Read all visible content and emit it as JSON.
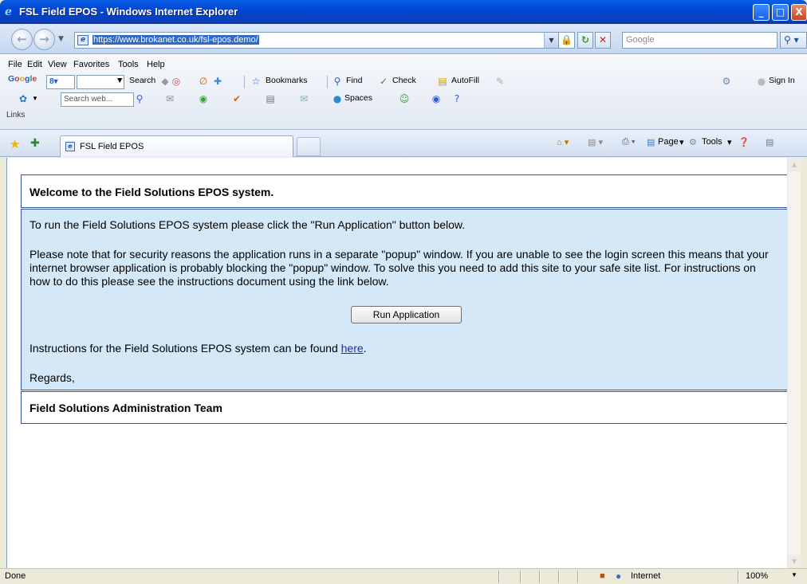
{
  "window": {
    "title": "FSL Field EPOS - Windows Internet Explorer",
    "min_glyph": "_",
    "max_glyph": "□",
    "close_glyph": "X"
  },
  "address": {
    "url": "https://www.brokanet.co.uk/fsl-epos.demo/",
    "search_placeholder": "Google"
  },
  "menu": {
    "items": [
      "File",
      "Edit",
      "View",
      "Favorites",
      "Tools",
      "Help"
    ]
  },
  "google_toolbar": {
    "logo": "Google",
    "search_label": "Search",
    "bookmarks_label": "Bookmarks",
    "find_label": "Find",
    "check_label": "Check",
    "autofill_label": "AutoFill",
    "sign_in_label": "Sign In"
  },
  "msn_toolbar": {
    "search_placeholder": "Search web...",
    "spaces_label": "Spaces"
  },
  "links_label": "Links",
  "tab": {
    "label": "FSL Field EPOS"
  },
  "command_bar": {
    "page_label": "Page",
    "tools_label": "Tools"
  },
  "page": {
    "welcome": "Welcome to the Field Solutions EPOS system.",
    "instruction": "To run the Field Solutions EPOS system please click the \"Run Application\" button below.",
    "note": "Please note that for security reasons the application runs in a separate \"popup\" window. If you are unable to see the login screen this means that your internet browser application is probably blocking the \"popup\" window. To solve this you need to add this site to your safe site list. For instructions on how to do this please see the instructions document using the link below.",
    "run_button": "Run Application",
    "instructions_prefix": "Instructions for the Field Solutions EPOS system can be found ",
    "instructions_link": "here",
    "instructions_suffix": ".",
    "regards": "Regards,",
    "signature": "Field Solutions Administration Team"
  },
  "status": {
    "text": "Done",
    "zone": "Internet",
    "zoom": "100%"
  },
  "colors": {
    "panel_bg": "#d4e8f8",
    "panel_border": "#33569e",
    "link": "#1a2fa6"
  }
}
